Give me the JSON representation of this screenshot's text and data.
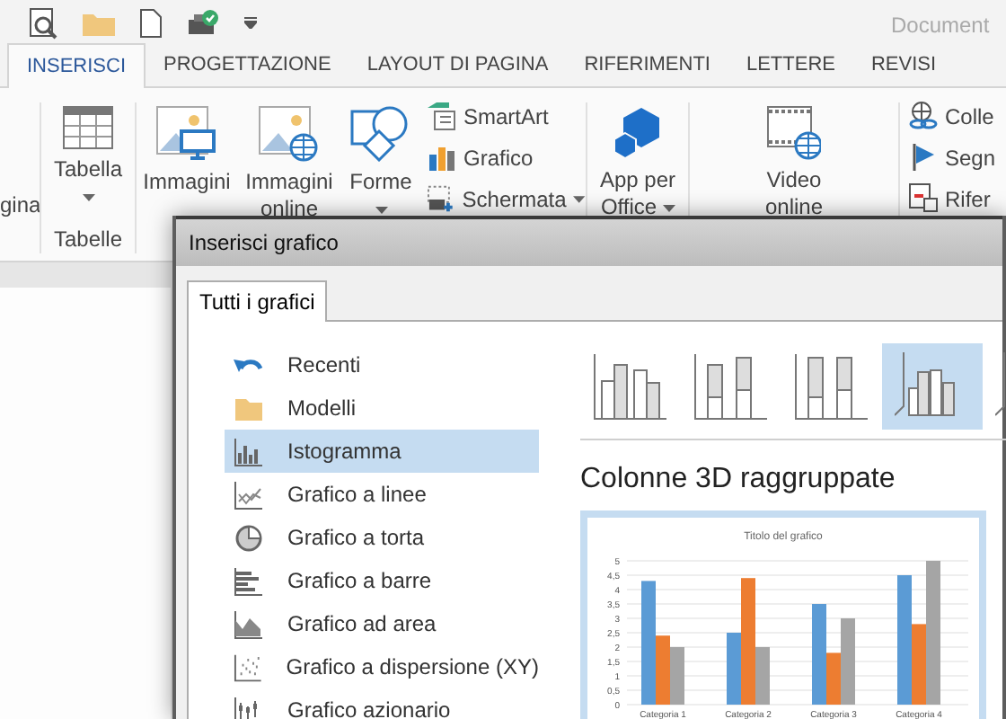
{
  "window": {
    "title": "Document"
  },
  "tabs": [
    {
      "label": "INSERISCI",
      "selected": true
    },
    {
      "label": "PROGETTAZIONE",
      "selected": false
    },
    {
      "label": "LAYOUT DI PAGINA",
      "selected": false
    },
    {
      "label": "RIFERIMENTI",
      "selected": false
    },
    {
      "label": "LETTERE",
      "selected": false
    },
    {
      "label": "REVISI",
      "selected": false
    }
  ],
  "ribbon": {
    "cut_label": "gina",
    "table_group": {
      "button": "Tabella",
      "dropdown": true,
      "label": "Tabelle"
    },
    "pictures": [
      {
        "lines": [
          "Immagini"
        ],
        "dropdown": false
      },
      {
        "lines": [
          "Immagini",
          "online"
        ],
        "dropdown": false
      },
      {
        "lines": [
          "Forme"
        ],
        "dropdown": true
      }
    ],
    "small": [
      {
        "label": "SmartArt",
        "dropdown": false
      },
      {
        "label": "Grafico",
        "dropdown": false
      },
      {
        "label": "Schermata",
        "dropdown": true
      }
    ],
    "apps": {
      "lines": [
        "App per",
        "Office"
      ],
      "dropdown": true
    },
    "video": {
      "lines": [
        "Video",
        "online"
      ],
      "dropdown": false
    },
    "links": [
      {
        "label": "Colle"
      },
      {
        "label": "Segn"
      },
      {
        "label": "Rifer"
      }
    ]
  },
  "dialog": {
    "title": "Inserisci grafico",
    "tabs": [
      {
        "label": "Tutti i grafici",
        "selected": true
      }
    ],
    "chart_types": [
      {
        "label": "Recenti",
        "selected": false
      },
      {
        "label": "Modelli",
        "selected": false
      },
      {
        "label": "Istogramma",
        "selected": true
      },
      {
        "label": "Grafico a linee",
        "selected": false
      },
      {
        "label": "Grafico a torta",
        "selected": false
      },
      {
        "label": "Grafico a barre",
        "selected": false
      },
      {
        "label": "Grafico ad area",
        "selected": false
      },
      {
        "label": "Grafico a dispersione (XY)",
        "selected": false
      },
      {
        "label": "Grafico azionario",
        "selected": false
      }
    ],
    "subtypes": [
      {
        "selected": false
      },
      {
        "selected": false
      },
      {
        "selected": false
      },
      {
        "selected": true
      },
      {
        "selected": false
      }
    ],
    "subtype_title": "Colonne 3D raggruppate",
    "preview": {
      "chart_data": {
        "type": "bar",
        "title": "Titolo del grafico",
        "categories": [
          "Categoria 1",
          "Categoria 2",
          "Categoria 3",
          "Categoria 4"
        ],
        "series": [
          {
            "color": "#5b9bd5",
            "values": [
              4.3,
              2.5,
              3.5,
              4.5
            ]
          },
          {
            "color": "#ed7d31",
            "values": [
              2.4,
              4.4,
              1.8,
              2.8
            ]
          },
          {
            "color": "#a5a5a5",
            "values": [
              2,
              2,
              3,
              5
            ]
          }
        ],
        "ylim": [
          0,
          5
        ],
        "grid": true,
        "yticks": [
          0,
          {
            "value": 0.5,
            "label": "0,5"
          },
          1,
          {
            "value": 1.5,
            "label": "1,5"
          },
          2,
          {
            "value": 2.5,
            "label": "2,5"
          },
          3,
          {
            "value": 3.5,
            "label": "3,5"
          },
          4,
          {
            "value": 4.5,
            "label": "4,5"
          },
          5
        ]
      }
    }
  }
}
